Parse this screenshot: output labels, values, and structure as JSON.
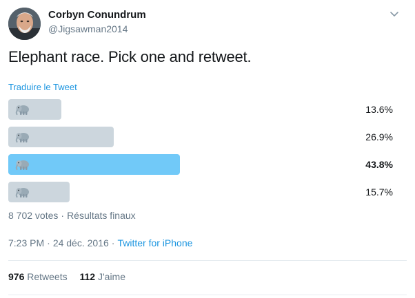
{
  "author": {
    "name": "Corbyn Conundrum",
    "handle": "@Jigsawman2014",
    "avatar_icon": "profile-photo"
  },
  "tweet": {
    "text": "Elephant race. Pick one and retweet.",
    "translate_link": "Traduire le Tweet"
  },
  "poll": {
    "choices": [
      {
        "label_icon": "elephant-emoji",
        "percent": "13.6%",
        "fraction": 0.136,
        "winner": false
      },
      {
        "label_icon": "elephant-emoji",
        "percent": "26.9%",
        "fraction": 0.269,
        "winner": false
      },
      {
        "label_icon": "elephant-emoji",
        "percent": "43.8%",
        "fraction": 0.438,
        "winner": true
      },
      {
        "label_icon": "elephant-emoji",
        "percent": "15.7%",
        "fraction": 0.157,
        "winner": false
      }
    ],
    "votes": "8 702 votes",
    "status": "Résultats finaux"
  },
  "meta": {
    "time": "7:23 PM",
    "date": "24 déc. 2016",
    "source": "Twitter for iPhone"
  },
  "stats": {
    "retweets_count": "976",
    "retweets_label": "Retweets",
    "likes_count": "112",
    "likes_label": "J'aime"
  },
  "colors": {
    "bar_default": "#ccd6dd",
    "bar_winner": "#71c9f8",
    "link": "#1b95e0",
    "secondary_text": "#657786"
  }
}
